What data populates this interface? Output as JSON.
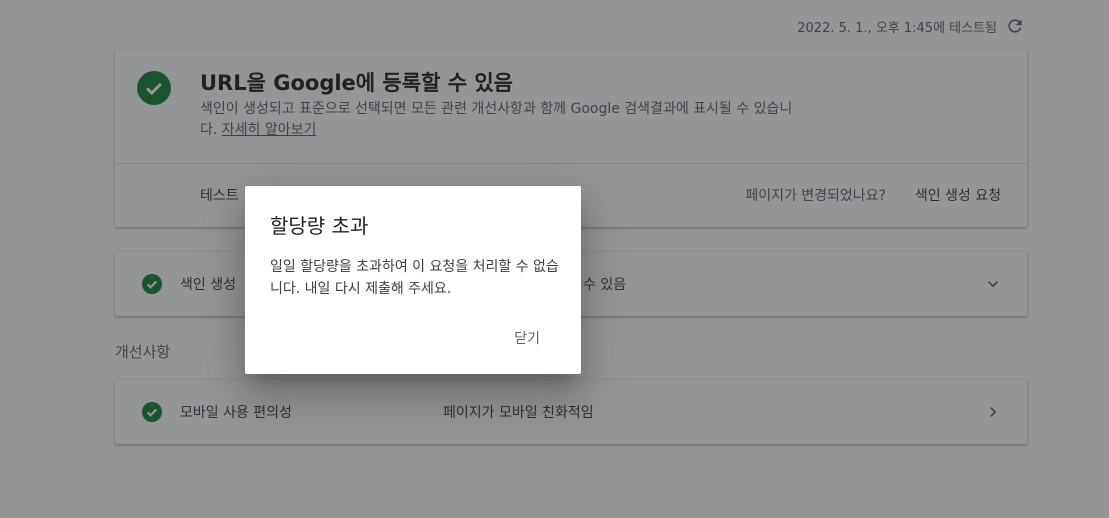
{
  "header": {
    "tested_timestamp": "2022. 5. 1., 오후 1:45에 테스트됨",
    "refresh_icon": "refresh-icon"
  },
  "main_card": {
    "status_icon": "check-circle-icon",
    "title": "URL을 Google에 등록할 수 있음",
    "description": "색인이 생성되고 표준으로 선택되면 모든 관련 개선사항과 함께 Google 검색결과에 표시될 수 있습니다.",
    "learn_more": "자세히 알아보기",
    "test_label": "테스트",
    "page_changed_text": "페이지가 변경되었나요?",
    "request_indexing_label": "색인 생성 요청"
  },
  "index_card": {
    "status_icon": "check-circle-icon",
    "title": "색인 생성",
    "value": "수 있음",
    "chevron_icon": "chevron-down-icon"
  },
  "enhancements": {
    "section_title": "개선사항",
    "mobile": {
      "status_icon": "check-circle-icon",
      "title": "모바일 사용 편의성",
      "value": "페이지가 모바일 친화적임",
      "chevron_icon": "chevron-right-icon"
    }
  },
  "dialog": {
    "title": "할당량 초과",
    "body": "일일 할당량을 초과하여 이 요청을 처리할 수 없습니다. 내일 다시 제출해 주세요.",
    "close_label": "닫기"
  },
  "colors": {
    "success": "#188038",
    "scrim": "#202124"
  }
}
